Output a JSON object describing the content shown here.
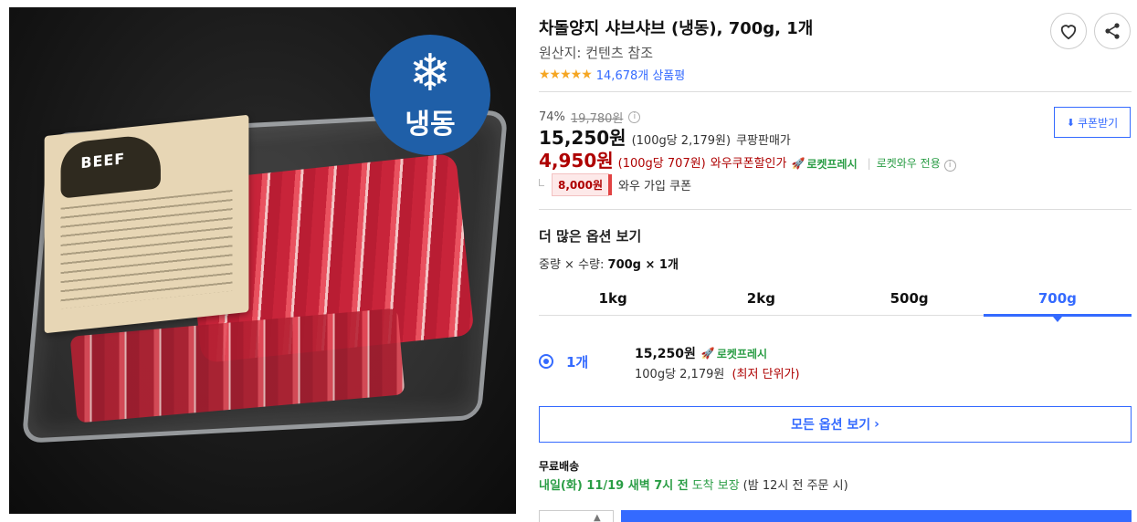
{
  "product": {
    "title": "차돌양지 샤브샤브 (냉동), 700g, 1개",
    "origin": "원산지: 컨텐츠 참조",
    "rating_stars": "★★★★★",
    "rating_value": 4.5,
    "review_count": "14,678개 상품평",
    "image": {
      "badge_text": "냉동",
      "badge_icon": "snowflake-icon",
      "label_text": "BEEF"
    }
  },
  "price": {
    "discount_rate": "74%",
    "original_price": "19,780원",
    "sale_price": "15,250원",
    "sale_unit": "(100g당 2,179원)",
    "sale_label": "쿠팡판매가",
    "coupon_button": "쿠폰받기",
    "wow_price": "4,950원",
    "wow_unit": "(100g당 707원)",
    "wow_label": "와우쿠폰할인가",
    "rocket_fresh": "로켓프레시",
    "wow_only": "로켓와우 전용",
    "join_coupon_amount": "8,000원",
    "join_coupon_label": "와우 가입 쿠폰"
  },
  "options": {
    "section_title": "더 많은 옵션 보기",
    "selection_prefix": "중량 × 수량:",
    "selection_value": "700g × 1개",
    "tabs": [
      "1kg",
      "2kg",
      "500g",
      "700g"
    ],
    "active_tab": "700g",
    "item": {
      "quantity": "1개",
      "price": "15,250원",
      "rocket_fresh": "로켓프레시",
      "unit_price": "100g당 2,179원",
      "lowest_note": "(최저 단위가)"
    },
    "all_options_button": "모든 옵션 보기"
  },
  "shipping": {
    "free_label": "무료배송",
    "arrival": "내일(화) 11/19 새벽 7시 전",
    "guarantee": "도착 보장",
    "condition": "(밤 12시 전 주문 시)"
  },
  "icons": {
    "wishlist": "heart-icon",
    "share": "share-icon",
    "download": "download-icon",
    "info": "info-icon",
    "chevron": "chevron-right-icon"
  },
  "colors": {
    "accent": "#346aff",
    "wow_red": "#ae0000",
    "rocket_green": "#2a9d45",
    "frozen_badge": "#1f5fa8",
    "star": "#f5a623"
  }
}
